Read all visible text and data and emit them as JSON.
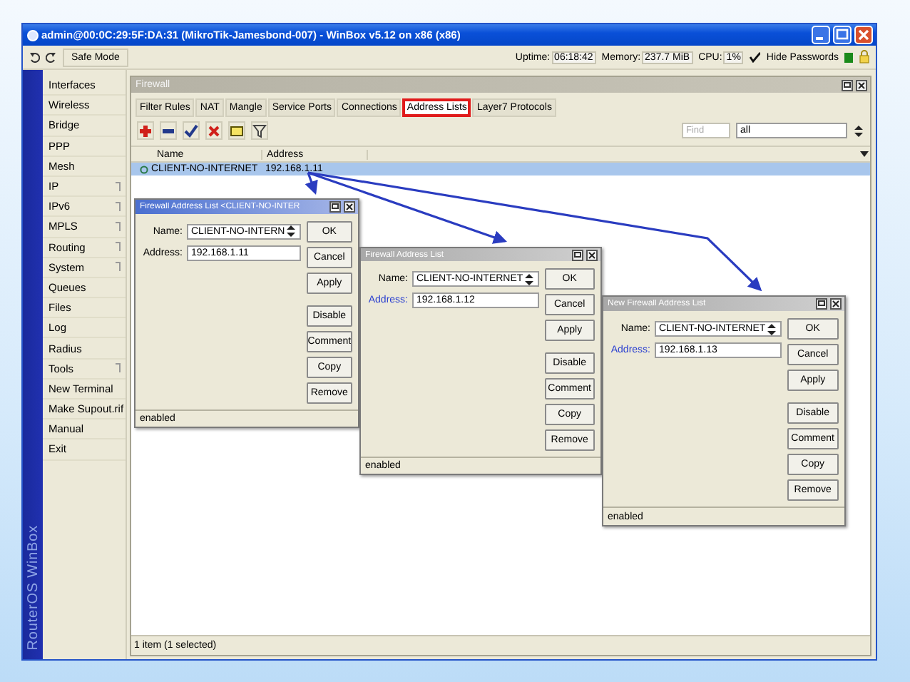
{
  "window": {
    "title": "admin@00:0C:29:5F:DA:31 (MikroTik-Jamesbond-007) - WinBox v5.12 on x86 (x86)"
  },
  "toolbar": {
    "safe_mode": "Safe Mode",
    "stats": [
      {
        "label": "Uptime:",
        "value": "06:18:42"
      },
      {
        "label": "Memory:",
        "value": "237.7 MiB"
      },
      {
        "label": "CPU:",
        "value": "1%"
      }
    ],
    "hide_passwords": {
      "label": "Hide Passwords",
      "checked": true
    }
  },
  "brand": "RouterOS WinBox",
  "sidebar": {
    "items": [
      {
        "label": "Interfaces",
        "submenu": false
      },
      {
        "label": "Wireless",
        "submenu": false
      },
      {
        "label": "Bridge",
        "submenu": false
      },
      {
        "label": "PPP",
        "submenu": false
      },
      {
        "label": "Mesh",
        "submenu": false
      },
      {
        "label": "IP",
        "submenu": true
      },
      {
        "label": "IPv6",
        "submenu": true
      },
      {
        "label": "MPLS",
        "submenu": true
      },
      {
        "label": "Routing",
        "submenu": true
      },
      {
        "label": "System",
        "submenu": true
      },
      {
        "label": "Queues",
        "submenu": false
      },
      {
        "label": "Files",
        "submenu": false
      },
      {
        "label": "Log",
        "submenu": false
      },
      {
        "label": "Radius",
        "submenu": false
      },
      {
        "label": "Tools",
        "submenu": true
      },
      {
        "label": "New Terminal",
        "submenu": false
      },
      {
        "label": "Make Supout.rif",
        "submenu": false
      },
      {
        "label": "Manual",
        "submenu": false
      },
      {
        "label": "Exit",
        "submenu": false
      }
    ]
  },
  "firewall": {
    "title": "Firewall",
    "tabs": [
      {
        "label": "Filter Rules",
        "selected": false,
        "highlighted": false
      },
      {
        "label": "NAT",
        "selected": false,
        "highlighted": false
      },
      {
        "label": "Mangle",
        "selected": false,
        "highlighted": false
      },
      {
        "label": "Service Ports",
        "selected": false,
        "highlighted": false
      },
      {
        "label": "Connections",
        "selected": false,
        "highlighted": false
      },
      {
        "label": "Address Lists",
        "selected": true,
        "highlighted": true
      },
      {
        "label": "Layer7 Protocols",
        "selected": false,
        "highlighted": false
      }
    ],
    "find": {
      "placeholder": "Find"
    },
    "filter": {
      "value": "all"
    },
    "table": {
      "columns": [
        "Name",
        "Address"
      ],
      "rows": [
        {
          "name": "CLIENT-NO-INTERNET",
          "address": "192.168.1.11",
          "selected": true
        }
      ]
    },
    "status": "1 item (1 selected)"
  },
  "dialogs": [
    {
      "title": "Firewall Address List <CLIENT-NO-INTER",
      "active": true,
      "fields": [
        {
          "label": "Name:",
          "value": "CLIENT-NO-INTERN",
          "kind": "dropdown",
          "highlighted": false
        },
        {
          "label": "Address:",
          "value": "192.168.1.11",
          "kind": "text",
          "highlighted": false
        }
      ],
      "buttons": [
        "OK",
        "Cancel",
        "Apply",
        "Disable",
        "Comment",
        "Copy",
        "Remove"
      ],
      "status": "enabled"
    },
    {
      "title": "Firewall Address List",
      "active": false,
      "fields": [
        {
          "label": "Name:",
          "value": "CLIENT-NO-INTERNET",
          "kind": "dropdown",
          "highlighted": false
        },
        {
          "label": "Address:",
          "value": "192.168.1.12",
          "kind": "text",
          "highlighted": true
        }
      ],
      "buttons": [
        "OK",
        "Cancel",
        "Apply",
        "Disable",
        "Comment",
        "Copy",
        "Remove"
      ],
      "status": "enabled"
    },
    {
      "title": "New Firewall Address List",
      "active": false,
      "fields": [
        {
          "label": "Name:",
          "value": "CLIENT-NO-INTERNET",
          "kind": "dropdown",
          "highlighted": false
        },
        {
          "label": "Address:",
          "value": "192.168.1.13",
          "kind": "text",
          "highlighted": true
        }
      ],
      "buttons": [
        "OK",
        "Cancel",
        "Apply",
        "Disable",
        "Comment",
        "Copy",
        "Remove"
      ],
      "status": "enabled"
    }
  ]
}
